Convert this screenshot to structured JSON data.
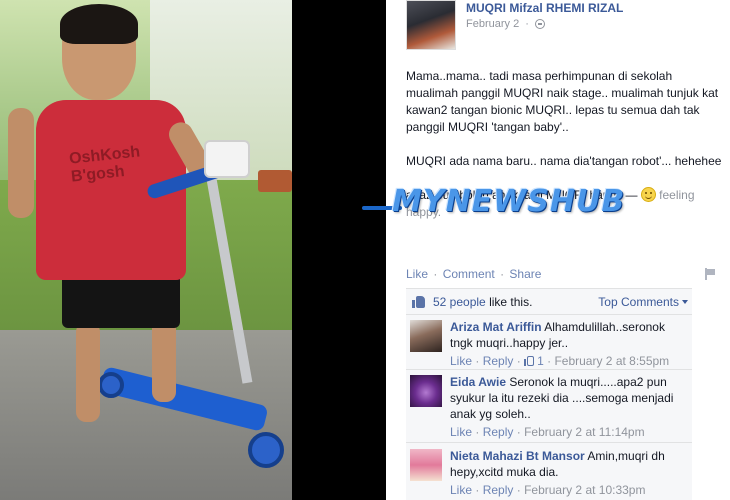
{
  "post": {
    "author": "MUQRI Mifzal RHEMI RIZAL",
    "date": "February 2",
    "paragraph1": "Mama..mama.. tadi masa perhimpunan di sekolah mualimah panggil MUQRI naik stage.. mualimah tunjuk kat kawan2 tangan bionic MUQRI.. lepas tu semua dah tak panggil MUQRI 'tangan baby'..",
    "paragraph2": "MUQRI ada nama baru.. nama dia'tangan robot'... hehehee",
    "paragraph3_text": "apa2 pun boleh anak janji MUQRI happy —",
    "paragraph3_feeling": "feeling happy.",
    "actions": {
      "like": "Like",
      "comment": "Comment",
      "share": "Share"
    }
  },
  "likes": {
    "count_text": "52 people",
    "suffix": "like this.",
    "top_comments": "Top Comments"
  },
  "comments": [
    {
      "name": "Ariza Mat Ariffin",
      "text": "Alhamdulillah..seronok tngk muqri..happy jer..",
      "like": "Like",
      "reply": "Reply",
      "like_count": "1",
      "time": "February 2 at 8:55pm"
    },
    {
      "name": "Eida Awie",
      "text": "Seronok la muqri.....apa2 pun syukur la itu rezeki dia ....semoga menjadi anak yg soleh..",
      "like": "Like",
      "reply": "Reply",
      "time": "February 2 at 11:14pm"
    },
    {
      "name": "Nieta Mahazi Bt Mansor",
      "text": "Amin,muqri dh hepy,xcitd muka dia.",
      "like": "Like",
      "reply": "Reply",
      "time": "February 2 at 10:33pm"
    }
  ],
  "photo": {
    "shirt_text": "OshKosh B'gosh"
  },
  "watermark": "MYNEWSHUB",
  "colors": {
    "link": "#3b5998",
    "muted": "#90949c",
    "watermark": "#4a96e8"
  }
}
